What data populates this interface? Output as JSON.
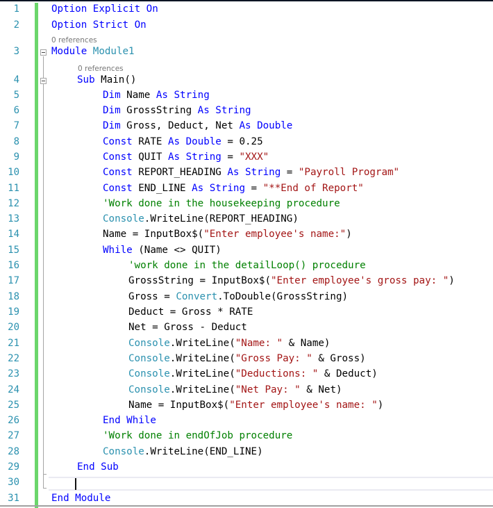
{
  "editor": {
    "language": "Visual Basic",
    "reference_codelens": "0 references",
    "current_line": 30,
    "colors": {
      "keyword": "#0000ff",
      "type": "#2b91af",
      "string": "#a31515",
      "comment": "#008000",
      "line_number": "#2b91af",
      "change_margin": "#6bd66b"
    },
    "lines": [
      {
        "n": "1",
        "tokens": [
          [
            "kw",
            "Option Explicit On"
          ]
        ]
      },
      {
        "n": "2",
        "tokens": [
          [
            "kw",
            "Option Strict On"
          ]
        ]
      },
      {
        "n": "3",
        "tokens": [
          [
            "kw",
            "Module "
          ],
          [
            "ty",
            "Module1"
          ]
        ]
      },
      {
        "n": "4",
        "tokens": [
          [
            "kw",
            "Sub "
          ],
          [
            "",
            "Main()"
          ]
        ]
      },
      {
        "n": "5",
        "tokens": [
          [
            "kw",
            "Dim "
          ],
          [
            "",
            "Name "
          ],
          [
            "kw",
            "As String"
          ]
        ]
      },
      {
        "n": "6",
        "tokens": [
          [
            "kw",
            "Dim "
          ],
          [
            "",
            "GrossString "
          ],
          [
            "kw",
            "As String"
          ]
        ]
      },
      {
        "n": "7",
        "tokens": [
          [
            "kw",
            "Dim "
          ],
          [
            "",
            "Gross, Deduct, Net "
          ],
          [
            "kw",
            "As Double"
          ]
        ]
      },
      {
        "n": "8",
        "tokens": [
          [
            "kw",
            "Const "
          ],
          [
            "",
            "RATE "
          ],
          [
            "kw",
            "As Double"
          ],
          [
            "",
            " = 0.25"
          ]
        ]
      },
      {
        "n": "9",
        "tokens": [
          [
            "kw",
            "Const "
          ],
          [
            "",
            "QUIT "
          ],
          [
            "kw",
            "As String"
          ],
          [
            "",
            " = "
          ],
          [
            "st",
            "\"XXX\""
          ]
        ]
      },
      {
        "n": "10",
        "tokens": [
          [
            "kw",
            "Const "
          ],
          [
            "",
            "REPORT_HEADING "
          ],
          [
            "kw",
            "As String"
          ],
          [
            "",
            " = "
          ],
          [
            "st",
            "\"Payroll Program\""
          ]
        ]
      },
      {
        "n": "11",
        "tokens": [
          [
            "kw",
            "Const "
          ],
          [
            "",
            "END_LINE "
          ],
          [
            "kw",
            "As String"
          ],
          [
            "",
            " = "
          ],
          [
            "st",
            "\"**End of Report\""
          ]
        ]
      },
      {
        "n": "12",
        "tokens": [
          [
            "cm",
            "'Work done in the housekeeping procedure"
          ]
        ]
      },
      {
        "n": "13",
        "tokens": [
          [
            "ty",
            "Console"
          ],
          [
            "",
            ".WriteLine(REPORT_HEADING)"
          ]
        ]
      },
      {
        "n": "14",
        "tokens": [
          [
            "",
            "Name = InputBox$("
          ],
          [
            "st",
            "\"Enter employee's name:\""
          ],
          [
            "",
            ")"
          ]
        ]
      },
      {
        "n": "15",
        "tokens": [
          [
            "kw",
            "While"
          ],
          [
            "",
            " (Name <> QUIT)"
          ]
        ]
      },
      {
        "n": "16",
        "tokens": [
          [
            "cm",
            "'work done in the detailLoop() procedure"
          ]
        ]
      },
      {
        "n": "17",
        "tokens": [
          [
            "",
            "GrossString = InputBox$("
          ],
          [
            "st",
            "\"Enter employee's gross pay: \""
          ],
          [
            "",
            ")"
          ]
        ]
      },
      {
        "n": "18",
        "tokens": [
          [
            "",
            "Gross = "
          ],
          [
            "ty",
            "Convert"
          ],
          [
            "",
            ".ToDouble(GrossString)"
          ]
        ]
      },
      {
        "n": "19",
        "tokens": [
          [
            "",
            "Deduct = Gross * RATE"
          ]
        ]
      },
      {
        "n": "20",
        "tokens": [
          [
            "",
            "Net = Gross - Deduct"
          ]
        ]
      },
      {
        "n": "21",
        "tokens": [
          [
            "ty",
            "Console"
          ],
          [
            "",
            ".WriteLine("
          ],
          [
            "st",
            "\"Name: \""
          ],
          [
            "",
            " & Name)"
          ]
        ]
      },
      {
        "n": "22",
        "tokens": [
          [
            "ty",
            "Console"
          ],
          [
            "",
            ".WriteLine("
          ],
          [
            "st",
            "\"Gross Pay: \""
          ],
          [
            "",
            " & Gross)"
          ]
        ]
      },
      {
        "n": "23",
        "tokens": [
          [
            "ty",
            "Console"
          ],
          [
            "",
            ".WriteLine("
          ],
          [
            "st",
            "\"Deductions: \""
          ],
          [
            "",
            " & Deduct)"
          ]
        ]
      },
      {
        "n": "24",
        "tokens": [
          [
            "ty",
            "Console"
          ],
          [
            "",
            ".WriteLine("
          ],
          [
            "st",
            "\"Net Pay: \""
          ],
          [
            "",
            " & Net)"
          ]
        ]
      },
      {
        "n": "25",
        "tokens": [
          [
            "",
            "Name = InputBox$("
          ],
          [
            "st",
            "\"Enter employee's name: \""
          ],
          [
            "",
            ")"
          ]
        ]
      },
      {
        "n": "26",
        "tokens": [
          [
            "kw",
            "End While"
          ]
        ]
      },
      {
        "n": "27",
        "tokens": [
          [
            "cm",
            "'Work done in endOfJob procedure"
          ]
        ]
      },
      {
        "n": "28",
        "tokens": [
          [
            "ty",
            "Console"
          ],
          [
            "",
            ".WriteLine(END_LINE)"
          ]
        ]
      },
      {
        "n": "29",
        "tokens": [
          [
            "kw",
            "End Sub"
          ]
        ]
      },
      {
        "n": "30",
        "tokens": []
      },
      {
        "n": "31",
        "tokens": [
          [
            "kw",
            "End Module"
          ]
        ]
      }
    ]
  }
}
